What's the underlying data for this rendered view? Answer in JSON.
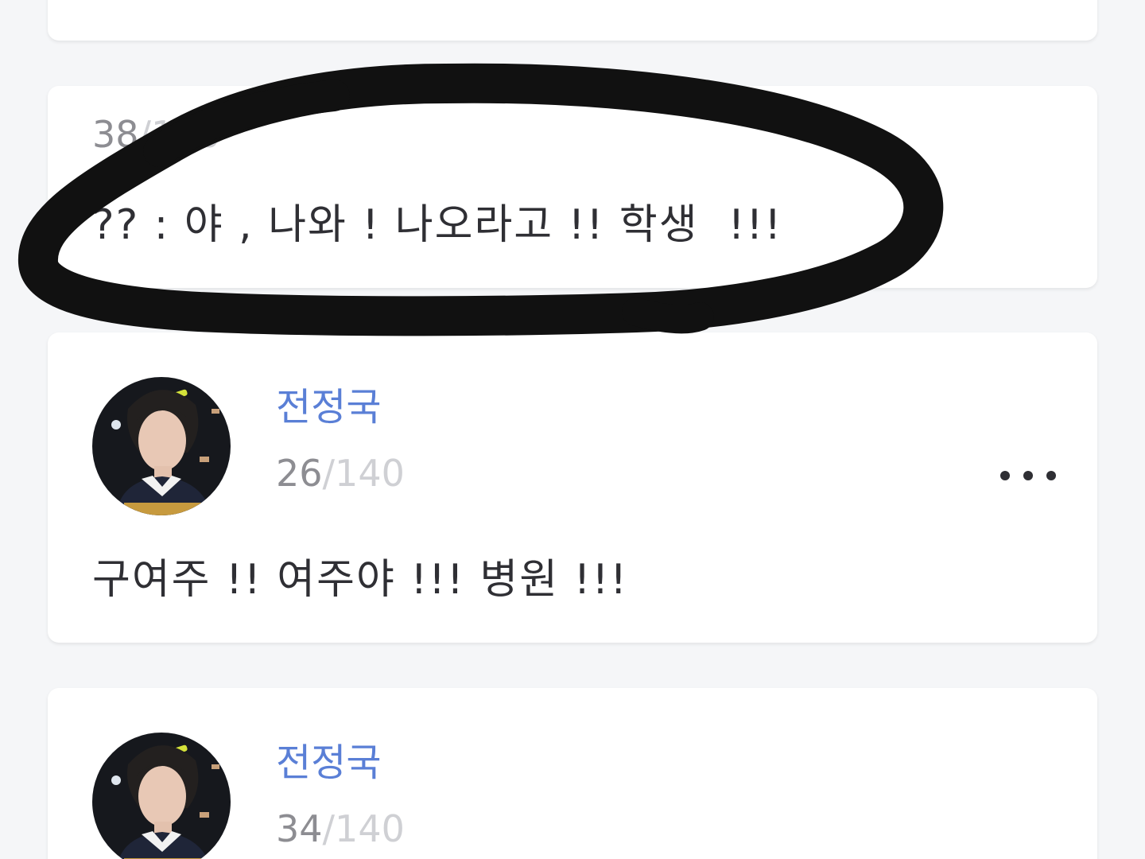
{
  "posts": [
    {
      "counter_current": "38",
      "counter_separator": "/",
      "counter_max": "140",
      "message": "?? : 야 , 나와 ! 나오라고 !! 학생  !!!"
    },
    {
      "author": "전정국",
      "counter_current": "26",
      "counter_separator": "/",
      "counter_max": "140",
      "message": "구여주 !! 여주야 !!! 병원 !!!"
    },
    {
      "author": "전정국",
      "counter_current": "34",
      "counter_separator": "/",
      "counter_max": "140"
    }
  ],
  "icons": {
    "more": "more-horizontal-icon",
    "avatar": "profile-avatar"
  },
  "colors": {
    "background": "#f5f6f8",
    "card": "#ffffff",
    "author": "#5a7fd6",
    "counter": "#8d8d92",
    "counter_max": "#cfd0d4",
    "text": "#2f2f34",
    "scribble": "#111111"
  }
}
